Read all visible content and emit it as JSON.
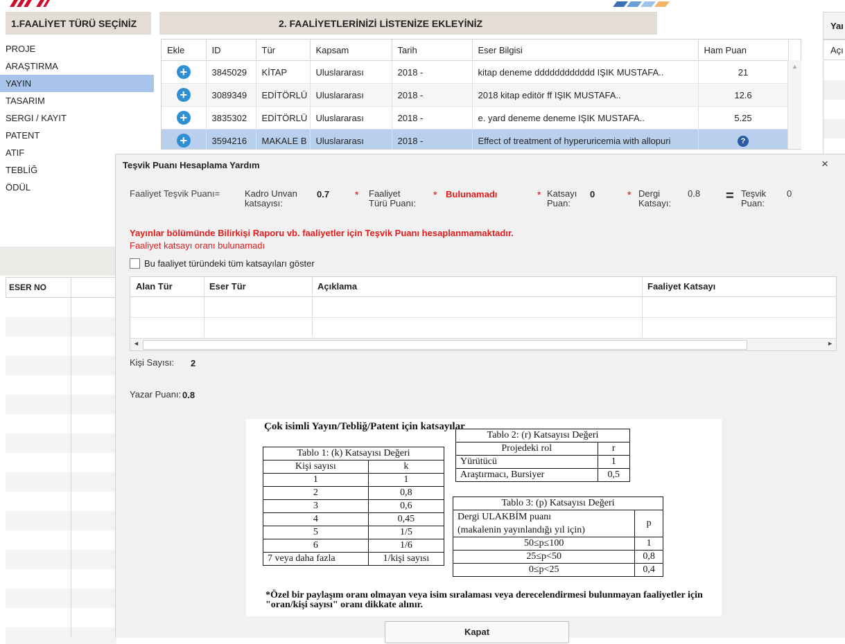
{
  "section1": {
    "title": "1.FAALİYET TÜRÜ SEÇİNİZ"
  },
  "section2": {
    "title": "2. FAALİYETLERİNİZİ LİSTENİZE EKLEYİNİZ"
  },
  "section3": {
    "title": "Yaı",
    "sub": "Açı"
  },
  "left_menu": [
    "PROJE",
    "ARAŞTIRMA",
    "YAYIN",
    "TASARIM",
    "SERGI / KAYIT",
    "PATENT",
    "ATIF",
    "TEBLİĞ",
    "ÖDÜL"
  ],
  "left_menu_selected": "YAYIN",
  "lower_left": {
    "col1": "ESER NO"
  },
  "activity_table": {
    "columns": [
      "Ekle",
      "ID",
      "Tür",
      "Kapsam",
      "Tarih",
      "Eser Bilgisi",
      "Ham Puan"
    ],
    "rows": [
      {
        "id": "3845029",
        "tur": "KİTAP",
        "kapsam": "Uluslararası",
        "tarih": "2018 -",
        "eser": "kitap deneme dddddddddddd IŞIK MUSTAFA..",
        "puan": "21"
      },
      {
        "id": "3089349",
        "tur": "EDİTÖRLÜ",
        "kapsam": "Uluslararası",
        "tarih": "2018 -",
        "eser": "2018 kitap editör ff IŞIK MUSTAFA..",
        "puan": "12.6"
      },
      {
        "id": "3835302",
        "tur": "EDİTÖRLÜ",
        "kapsam": "Uluslararası",
        "tarih": "2018 -",
        "eser": "e. yard deneme deneme IŞIK MUSTAFA..",
        "puan": "5.25"
      },
      {
        "id": "3594216",
        "tur": "MAKALE B",
        "kapsam": "Uluslararası",
        "tarih": "2018 -",
        "eser": "Effect of treatment of hyperuricemia with allopuri",
        "puan": "?"
      }
    ]
  },
  "modal": {
    "title": "Teşvik Puanı Hesaplama Yardım",
    "close": "×",
    "formula": {
      "label": "Faaliyet Teşvik Puanı=",
      "kadro_label": "Kadro Unvan katsayısı:",
      "kadro_value": "0.7",
      "tur_label": "Faaliyet Türü Puanı:",
      "tur_value": "Bulunamadı",
      "katsayi_label": "Katsayı Puan:",
      "katsayi_value": "0",
      "dergi_label": "Dergi Katsayı:",
      "dergi_value": "0.8",
      "tesvik_label": "Teşvik Puan:",
      "tesvik_value": "0",
      "star": "*",
      "equals": "="
    },
    "warning_bold": "Yayınlar bölümünde Bilirkişi Raporu vb. faaliyetler için Teşvik Puanı hesaplanmamaktadır.",
    "warning": "Faaliyet katsayı oranı bulunamadı",
    "checkbox_label": "Bu faaliyet türündeki tüm katsayıları göster",
    "coef_columns": [
      "Alan Tür",
      "Eser Tür",
      "Açıklama",
      "Faaliyet Katsayı"
    ],
    "kisi_label": "Kişi Sayısı:",
    "kisi_value": "2",
    "yazar_label": "Yazar Puanı:",
    "yazar_value": "0.8",
    "close_button": "Kapat"
  },
  "scan": {
    "title": "Çok isimli Yayın/Tebliğ/Patent için katsayılar",
    "t1_title": "Tablo 1: (k) Katsayısı Değeri",
    "t1_head": [
      "Kişi sayısı",
      "k"
    ],
    "t1_rows": [
      [
        "1",
        "1"
      ],
      [
        "2",
        "0,8"
      ],
      [
        "3",
        "0,6"
      ],
      [
        "4",
        "0,45"
      ],
      [
        "5",
        "1/5"
      ],
      [
        "6",
        "1/6"
      ],
      [
        "7 veya daha fazla",
        "1/kişi sayısı"
      ]
    ],
    "t2_title": "Tablo 2: (r) Katsayısı Değeri",
    "t2_head": [
      "Projedeki rol",
      "r"
    ],
    "t2_rows": [
      [
        "Yürütücü",
        "1"
      ],
      [
        "Araştırmacı, Bursiyer",
        "0,5"
      ]
    ],
    "t3_title": "Tablo 3: (p) Katsayısı Değeri",
    "t3_head1": "Dergi ULAKBİM puanı",
    "t3_head2": "(makalenin yayınlandığı yıl için)",
    "t3_p": "p",
    "t3_rows": [
      [
        "50≤p≤100",
        "1"
      ],
      [
        "25≤p<50",
        "0,8"
      ],
      [
        "0≤p<25",
        "0,4"
      ]
    ],
    "note": "*Özel bir paylaşım oranı olmayan veya isim sıralaması veya derecelendirmesi bulunmayan faaliyetler için \"oran/kişi sayısı\" oranı dikkate alınır."
  }
}
